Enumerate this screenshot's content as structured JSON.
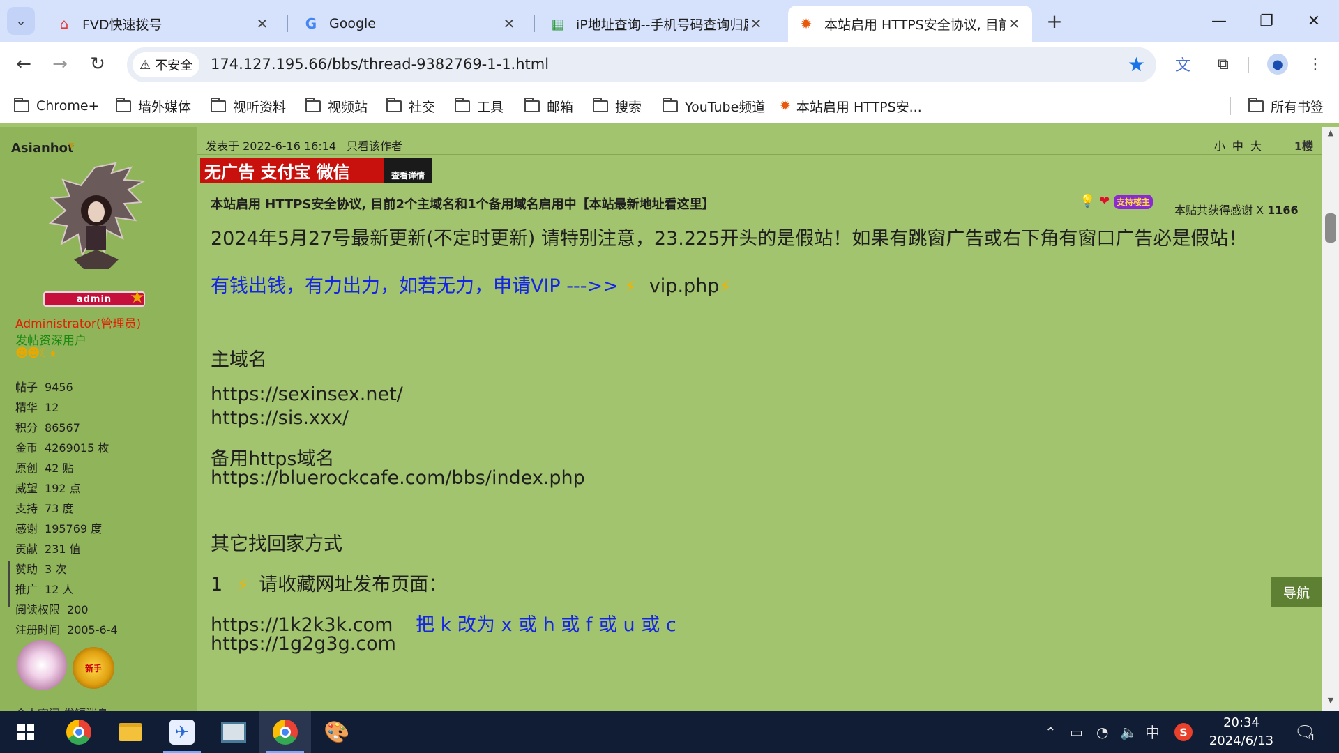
{
  "browser": {
    "tabs": [
      {
        "title": "FVD快速拨号",
        "active": false
      },
      {
        "title": "Google",
        "active": false
      },
      {
        "title": "iP地址查询--手机号码查询归属",
        "active": false
      },
      {
        "title": "本站启用 HTTPS安全协议, 目前",
        "active": true
      }
    ],
    "security_label": "不安全",
    "url": "174.127.195.66/bbs/thread-9382769-1-1.html",
    "bookmarks": [
      "Chrome+",
      "墙外媒体",
      "视听资料",
      "视频站",
      "社交",
      "工具",
      "邮箱",
      "搜索",
      "YouTube频道",
      "本站启用 HTTPS安..."
    ],
    "all_bookmarks": "所有书签"
  },
  "profile": {
    "username": "Asianhot",
    "badge": "admin",
    "role": "Administrator(管理员)",
    "level": "发帖资深用户",
    "stats": [
      {
        "label": "帖子",
        "value": "9456"
      },
      {
        "label": "精华",
        "value": "12"
      },
      {
        "label": "积分",
        "value": "86567"
      },
      {
        "label": "金币",
        "value": "4269015 枚"
      },
      {
        "label": "原创",
        "value": "42 贴"
      },
      {
        "label": "威望",
        "value": "192 点"
      },
      {
        "label": "支持",
        "value": "73 度"
      },
      {
        "label": "感谢",
        "value": "195769 度"
      },
      {
        "label": "贡献",
        "value": "231 值"
      },
      {
        "label": "赞助",
        "value": "3 次"
      },
      {
        "label": "推广",
        "value": "12 人"
      },
      {
        "label": "阅读权限",
        "value": "200"
      },
      {
        "label": "注册时间",
        "value": "2005-6-4"
      }
    ],
    "medal2_text": "新手",
    "footer": "个人空间   发短消息"
  },
  "post": {
    "date": "发表于 2022-6-16 16:14",
    "author_only": "只看该作者",
    "font_sizes": "小 中 大",
    "floor": "1楼",
    "ad_text": "无广告 支付宝 微信",
    "ad_detail": "查看详情",
    "title": "本站启用 HTTPS安全协议, 目前2个主域名和1个备用域名启用中【本站最新地址看这里】",
    "thanks_badge": "支持楼主",
    "thanks_label": "本贴共获得感谢 X",
    "thanks_count": "1166",
    "update_notice": "2024年5月27号最新更新(不定时更新) 请特别注意，23.225开头的是假站！如果有跳窗广告或右下角有窗口广告必是假站！",
    "vip_text": "有钱出钱，有力出力，如若无力，申请VIP --->>",
    "vip_link": "vip.php",
    "main_domain_heading": "主域名",
    "main_domains": [
      "https://sexinsex.net/",
      "https://sis.xxx/"
    ],
    "backup_heading": "备用https域名",
    "backup_domain": "https://bluerockcafe.com/bbs/index.php",
    "other_heading": "其它找回家方式",
    "step1_num": "1",
    "step1_text": "请收藏网址发布页面：",
    "publish_urls": [
      "https://1k2k3k.com",
      "https://1g2g3g.com"
    ],
    "replace_hint": "把 k 改为 x 或 h 或 f 或 u 或 c",
    "nav_button": "导航"
  },
  "taskbar": {
    "ime": "中",
    "time": "20:34",
    "date": "2024/6/13",
    "notifications": "1"
  }
}
